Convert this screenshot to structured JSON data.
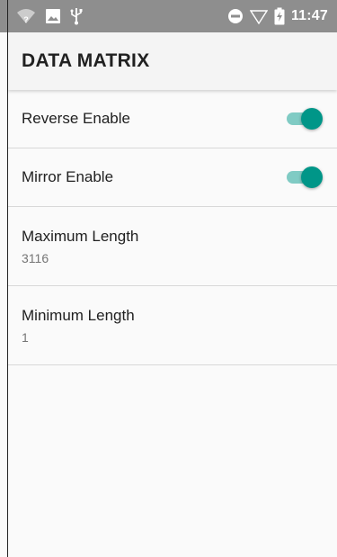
{
  "status_bar": {
    "time": "11:47",
    "left_icons": [
      "wifi-unknown-icon",
      "image-icon",
      "usb-icon"
    ],
    "right_icons": [
      "do-not-disturb-icon",
      "signal-icon",
      "battery-charging-icon"
    ]
  },
  "toolbar": {
    "title": "DATA MATRIX"
  },
  "preferences": [
    {
      "title": "Reverse Enable",
      "type": "switch",
      "checked": true
    },
    {
      "title": "Mirror Enable",
      "type": "switch",
      "checked": true
    },
    {
      "title": "Maximum Length",
      "type": "value",
      "summary": "3116"
    },
    {
      "title": "Minimum Length",
      "type": "value",
      "summary": "1"
    }
  ],
  "colors": {
    "status_bar": "#8e8e8e",
    "accent": "#009688",
    "accent_track": "#80cbc4",
    "toolbar": "#f4f4f4"
  }
}
